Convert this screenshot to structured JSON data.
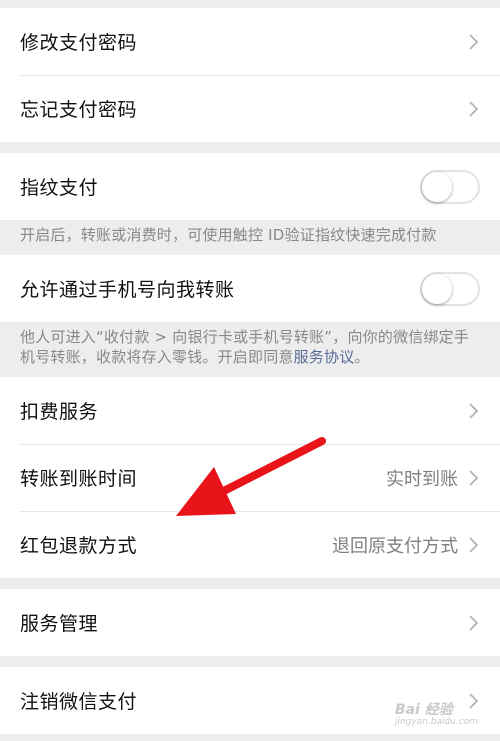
{
  "group1": {
    "modify_password": "修改支付密码",
    "forgot_password": "忘记支付密码"
  },
  "fingerprint": {
    "label": "指纹支付",
    "enabled": false,
    "note": "开启后，转账或消费时，可使用触控 ID验证指纹快速完成付款"
  },
  "phone_transfer": {
    "label": "允许通过手机号向我转账",
    "enabled": false,
    "note_prefix": "他人可进入“收付款 > 向银行卡或手机号转账”，向你的微信绑定手机号转账，收款将存入零钱。开启即同意",
    "note_link": "服务协议",
    "note_suffix": "。"
  },
  "group3": {
    "deduction_service": "扣费服务",
    "transfer_time_label": "转账到账时间",
    "transfer_time_value": "实时到账",
    "red_packet_refund_label": "红包退款方式",
    "red_packet_refund_value": "退回原支付方式"
  },
  "group4": {
    "service_management": "服务管理"
  },
  "group5": {
    "cancel_wechat_pay": "注销微信支付"
  },
  "annotation": {
    "arrow_color": "#e8141a"
  },
  "watermark": {
    "brand": "Bai 经验",
    "url": "jingyan.baidu.com"
  },
  "icons": {
    "chevron": "chevron-right-icon"
  }
}
